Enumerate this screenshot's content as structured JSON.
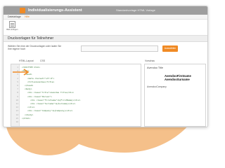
{
  "window": {
    "app_title": "Individualisierungs-Assistent",
    "document_title": "Standardvorlage HTML Vorlage"
  },
  "menu": [
    {
      "label": "Dateiablage",
      "active": false
    },
    {
      "label": "Hilfe",
      "active": true
    }
  ],
  "ribbon": {
    "button_label": "Bild einfügen"
  },
  "section": {
    "title": "Druckvorlagen für Teilnehmer"
  },
  "template_selector": {
    "hint": "Wählen Sie eine der Druckvorlagen oder laden Sie Ihre eigene hoch",
    "value": "",
    "button_label": "Auswählen"
  },
  "tabs": {
    "html": "HTML-Layout",
    "css": "CSS",
    "preview": "Vorschau"
  },
  "code_lines": [
    {
      "n": "1",
      "indent": 0,
      "text": "<!DOCTYPE html>"
    },
    {
      "n": "2",
      "indent": 0,
      "text": "<html>"
    },
    {
      "n": "3",
      "indent": 1,
      "text": "<head>"
    },
    {
      "n": "4",
      "indent": 2,
      "text": "<meta charset=\"utf-8\">"
    },
    {
      "n": "5",
      "indent": 2,
      "text": "<title>Avendoo</title>"
    },
    {
      "n": "6",
      "indent": 1,
      "text": "</head>"
    },
    {
      "n": "7",
      "indent": 1,
      "text": "<body>"
    },
    {
      "n": "8",
      "indent": 2,
      "text": "<div class=\"title\">Avendoo Title</div>"
    },
    {
      "n": "9",
      "indent": 2,
      "text": "<div class=\"Person\">"
    },
    {
      "n": "10",
      "indent": 3,
      "text": "<div class=\"Firstname\">${FirstName}</div>"
    },
    {
      "n": "11",
      "indent": 3,
      "text": "<div class=\"Surname\">${Surname}</div>"
    },
    {
      "n": "12",
      "indent": 2,
      "text": "</div>"
    },
    {
      "n": "13",
      "indent": 2,
      "text": "<div class=\"Company\">${Company}</div>"
    },
    {
      "n": "14",
      "indent": 1,
      "text": "</body>"
    },
    {
      "n": "15",
      "indent": 0,
      "text": "</html>"
    },
    {
      "n": "16",
      "indent": 0,
      "text": ""
    }
  ],
  "preview": {
    "title": "Avendoo Title",
    "firstname": "AvendooFirstname",
    "surname": "AvendooSurname",
    "company": "AvendooCompany"
  },
  "colors": {
    "accent": "#f08a24",
    "blob": "#f5c08a",
    "titlebar": "#9e9e9e",
    "code_text": "#3a7a3a"
  }
}
